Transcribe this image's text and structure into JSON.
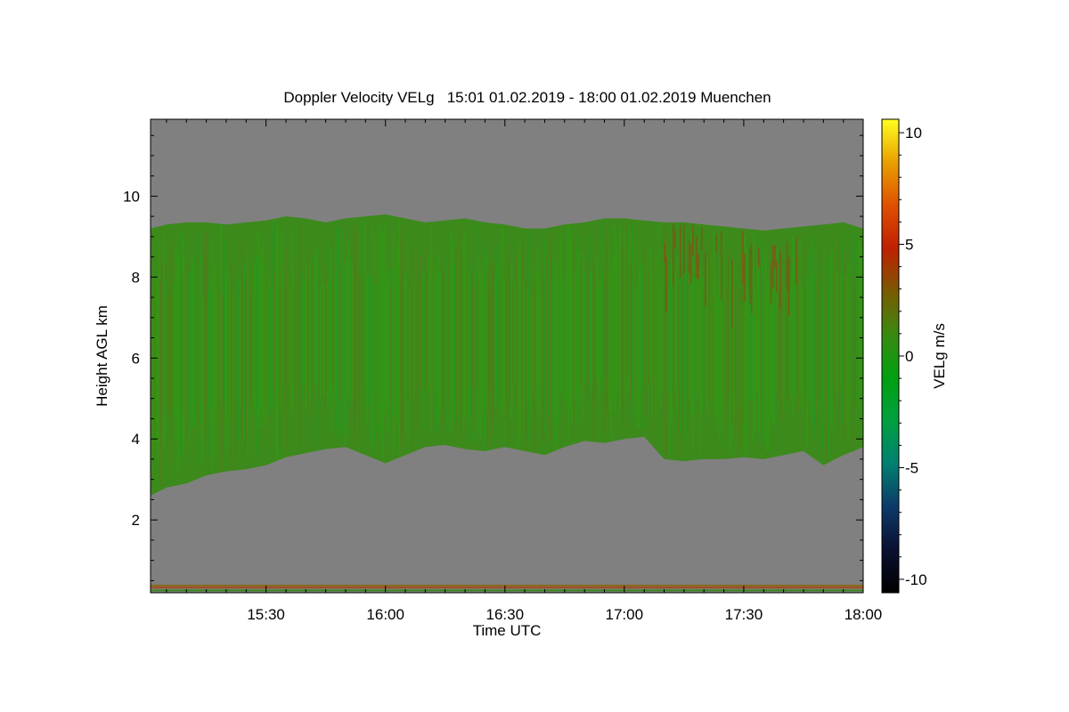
{
  "chart_data": {
    "type": "heatmap",
    "title": "Doppler Velocity VELg   15:01 01.02.2019 - 18:00 01.02.2019 Muenchen",
    "xlabel": "Time UTC",
    "ylabel": "Height AGL km",
    "colorbar_label": "VELg m/s",
    "x_range_minutes_utc": [
      901,
      1080
    ],
    "xlim": [
      "15:01",
      "18:00"
    ],
    "x_ticks": [
      "15:30",
      "16:00",
      "16:30",
      "17:00",
      "17:30",
      "18:00"
    ],
    "ylim_km": [
      0.2,
      11.9
    ],
    "y_ticks": [
      2,
      4,
      6,
      8,
      10
    ],
    "colorbar_range": [
      -10.6,
      10.6
    ],
    "colorbar_ticks": [
      -10,
      -5,
      0,
      5,
      10
    ],
    "colorscale": [
      "#000000",
      "#0a1030",
      "#0c3a6a",
      "#008070",
      "#00a040",
      "#00a010",
      "#3a8a10",
      "#7a5a00",
      "#c02000",
      "#e05000",
      "#e8a000",
      "#ffff20"
    ],
    "no_data_color": "#808080",
    "cloud_base_km": {
      "time": [
        "15:01",
        "15:05",
        "15:10",
        "15:15",
        "15:20",
        "15:25",
        "15:30",
        "15:35",
        "15:40",
        "15:45",
        "15:50",
        "15:55",
        "16:00",
        "16:05",
        "16:10",
        "16:15",
        "16:20",
        "16:25",
        "16:30",
        "16:35",
        "16:40",
        "16:45",
        "16:50",
        "16:55",
        "17:00",
        "17:05",
        "17:10",
        "17:15",
        "17:20",
        "17:25",
        "17:30",
        "17:35",
        "17:40",
        "17:45",
        "17:50",
        "17:55",
        "18:00"
      ],
      "height": [
        2.6,
        2.8,
        2.9,
        3.1,
        3.2,
        3.25,
        3.35,
        3.55,
        3.65,
        3.75,
        3.8,
        3.6,
        3.4,
        3.6,
        3.8,
        3.85,
        3.75,
        3.7,
        3.8,
        3.7,
        3.6,
        3.8,
        3.95,
        3.9,
        4.0,
        4.05,
        3.5,
        3.45,
        3.5,
        3.5,
        3.55,
        3.5,
        3.6,
        3.7,
        3.35,
        3.6,
        3.8
      ]
    },
    "cloud_top_km": {
      "time": [
        "15:01",
        "15:05",
        "15:10",
        "15:15",
        "15:20",
        "15:25",
        "15:30",
        "15:35",
        "15:40",
        "15:45",
        "15:50",
        "15:55",
        "16:00",
        "16:05",
        "16:10",
        "16:15",
        "16:20",
        "16:25",
        "16:30",
        "16:35",
        "16:40",
        "16:45",
        "16:50",
        "16:55",
        "17:00",
        "17:05",
        "17:10",
        "17:15",
        "17:20",
        "17:25",
        "17:30",
        "17:35",
        "17:40",
        "17:45",
        "17:50",
        "17:55",
        "18:00"
      ],
      "height": [
        9.2,
        9.3,
        9.35,
        9.35,
        9.3,
        9.35,
        9.4,
        9.5,
        9.45,
        9.35,
        9.45,
        9.5,
        9.55,
        9.45,
        9.35,
        9.4,
        9.45,
        9.35,
        9.3,
        9.2,
        9.2,
        9.3,
        9.35,
        9.45,
        9.45,
        9.4,
        9.35,
        9.35,
        9.3,
        9.25,
        9.2,
        9.15,
        9.2,
        9.25,
        9.3,
        9.35,
        9.2
      ]
    }
  }
}
